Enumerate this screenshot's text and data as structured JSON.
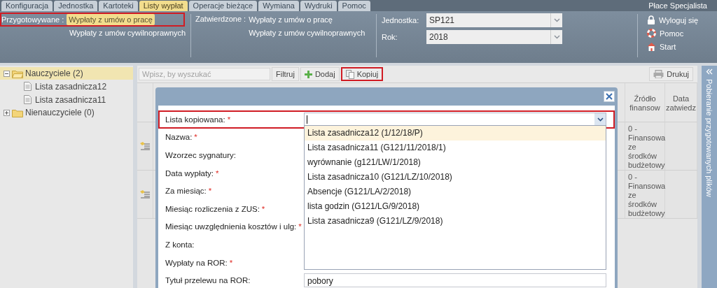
{
  "top_tabs": [
    {
      "label": "Konfiguracja",
      "selected": false
    },
    {
      "label": "Jednostka",
      "selected": false
    },
    {
      "label": "Kartoteki",
      "selected": false
    },
    {
      "label": "Listy wypłat",
      "selected": true
    },
    {
      "label": "Operacje bieżące",
      "selected": false
    },
    {
      "label": "Wymiana",
      "selected": false
    },
    {
      "label": "Wydruki",
      "selected": false
    },
    {
      "label": "Pomoc",
      "selected": false
    }
  ],
  "app_name": "Płace Specjalista",
  "prepared": {
    "label": "Przygotowywane :",
    "highlighted": true,
    "items": [
      {
        "label": "Wypłaty z umów o pracę",
        "selected": true
      },
      {
        "label": "Wypłaty z umów cywilnoprawnych",
        "selected": false
      }
    ]
  },
  "approved": {
    "label": "Zatwierdzone :",
    "items": [
      {
        "label": "Wypłaty z umów o pracę",
        "selected": false
      },
      {
        "label": "Wypłaty z umów cywilnoprawnych",
        "selected": false
      }
    ]
  },
  "filters": [
    {
      "label": "Jednostka:",
      "value": "SP121"
    },
    {
      "label": "Rok:",
      "value": "2018"
    }
  ],
  "user_links": [
    {
      "label": "Wyloguj się"
    },
    {
      "label": "Pomoc"
    },
    {
      "label": "Start"
    }
  ],
  "tree": [
    {
      "label": "Nauczyciele (2)",
      "selected": true,
      "expanded": true,
      "children": [
        {
          "label": "Lista zasadnicza12"
        },
        {
          "label": "Lista zasadnicza11"
        }
      ]
    },
    {
      "label": "Nienauczyciele (0)",
      "selected": false,
      "expanded": false
    }
  ],
  "toolbar": {
    "search": {
      "placeholder": "Wpisz, by wyszukać"
    },
    "buttons": [
      {
        "label": "Filtruj",
        "highlighted": false
      },
      {
        "label": "Dodaj",
        "highlighted": false
      },
      {
        "label": "Kopiuj",
        "highlighted": true
      }
    ],
    "print_button": {
      "label": "Drukuj"
    }
  },
  "grid": {
    "columns": [
      "Źródło finansow",
      "Data zatwiedz"
    ],
    "rows": [
      {
        "source": "0 - Finansowa ze środków budżetowy"
      },
      {
        "source": "0 - Finansowa ze środków budżetowy"
      }
    ]
  },
  "side_panel": {
    "title": "Pobieranie przygotowanych plików"
  },
  "dialog": {
    "fields": [
      {
        "label": "Lista kopiowana:",
        "required": true,
        "highlighted": true,
        "kind": "combo"
      },
      {
        "label": "Nazwa:",
        "required": true,
        "highlighted": false,
        "kind": "hidden"
      },
      {
        "label": "Wzorzec sygnatury:",
        "required": false,
        "highlighted": false,
        "kind": "hidden"
      },
      {
        "label": "Data wypłaty:",
        "required": true,
        "highlighted": false,
        "kind": "hidden"
      },
      {
        "label": "Za miesiąc:",
        "required": true,
        "highlighted": false,
        "kind": "hidden"
      },
      {
        "label": "Miesiąc rozliczenia z ZUS:",
        "required": true,
        "highlighted": false,
        "kind": "hidden"
      },
      {
        "label": "Miesiąc uwzględnienia kosztów i ulg:",
        "required": true,
        "highlighted": false,
        "kind": "hidden"
      },
      {
        "label": "Z konta:",
        "required": false,
        "highlighted": false,
        "kind": "hidden"
      },
      {
        "label": "Wypłaty na ROR:",
        "required": true,
        "highlighted": false,
        "kind": "hidden"
      },
      {
        "label": "Tytuł przelewu na ROR:",
        "required": false,
        "highlighted": false,
        "kind": "text",
        "value": "pobory"
      }
    ],
    "required_mark": "*",
    "dropdown": [
      {
        "label": "Lista zasadnicza12 (1/12/18/P)",
        "selected": true
      },
      {
        "label": "Lista zasadnicza11 (G121/11/2018/1)",
        "selected": false
      },
      {
        "label": "wyrównanie (g121/LW/1/2018)",
        "selected": false
      },
      {
        "label": "Lista zasadnicza10 (G121/LZ/10/2018)",
        "selected": false
      },
      {
        "label": "Absencje (G121/LA/2/2018)",
        "selected": false
      },
      {
        "label": "lista godzin (G121/LG/9/2018)",
        "selected": false
      },
      {
        "label": "Lista zasadnicza9 (G121/LZ/9/2018)",
        "selected": false
      }
    ]
  }
}
